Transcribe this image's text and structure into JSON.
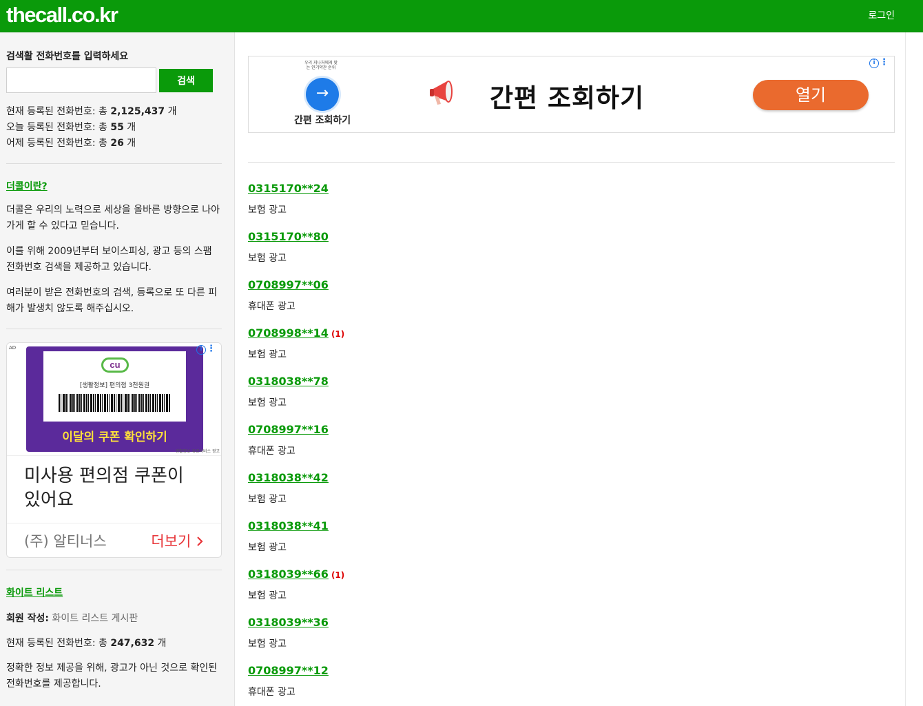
{
  "header": {
    "logo": "thecall.co.kr",
    "login": "로그인"
  },
  "sidebar": {
    "search_title": "검색활 전화번호를 입력하세요",
    "search_button": "검색",
    "stats": [
      {
        "prefix": "현재 등록된 전화번호: 총 ",
        "value": "2,125,437",
        "suffix": " 개"
      },
      {
        "prefix": "오늘 등록된 전화번호: 총 ",
        "value": "55",
        "suffix": " 개"
      },
      {
        "prefix": "어제 등록된 전화번호: 총 ",
        "value": "26",
        "suffix": " 개"
      }
    ],
    "about_link": "더콜이란?",
    "about_paragraphs": [
      "더콜은 우리의 노력으로 세상을 올바른 방향으로 나아가게 할 수 있다고 믿습니다.",
      "이를 위해 2009년부터 보이스피싱, 광고 등의 스팸 전화번호 검색을 제공하고 있습니다.",
      "여러분이 받은 전화번호의 검색, 등록으로 또 다른 피해가 발생치 않도록 해주십시오."
    ],
    "ad": {
      "tag": "AD",
      "brand": "cu",
      "ticket_label": "[생활정보] 편의점 3천원권",
      "ticket_cta": "이달의 쿠폰 확인하기",
      "fine_print": "생활정보 유료서비스 광고",
      "headline": "미사용 편의점 쿠폰이 있어요",
      "advertiser": "(주) 알티너스",
      "more": "더보기",
      "info_icon": "i",
      "dots": "⋮"
    },
    "whitelist_link": "화이트 리스트",
    "member_label": "회원 작성:",
    "member_value": " 화이트 리스트 게시판",
    "whitelist_count_prefix": "현재 등록된 전화번호: 총 ",
    "whitelist_count_value": "247,632",
    "whitelist_count_suffix": " 개",
    "whitelist_info": "정확한 정보 제공을 위해, 광고가 아닌 것으로 확인된 전화번호를 제공합니다."
  },
  "banner": {
    "mini_text": "우리 지나처에게 맞는 인기약관 순위",
    "arrow": "→",
    "sub": "간편 조회하기",
    "title": "간편 조회하기",
    "button": "열기",
    "info_icon": "i",
    "dots": "⋮"
  },
  "phones": [
    {
      "number": "0315170**24",
      "count": "",
      "category": "보험 광고"
    },
    {
      "number": "0315170**80",
      "count": "",
      "category": "보험 광고"
    },
    {
      "number": "0708997**06",
      "count": "",
      "category": "휴대폰 광고"
    },
    {
      "number": "0708998**14",
      "count": "(1)",
      "category": "보험 광고"
    },
    {
      "number": "0318038**78",
      "count": "",
      "category": "보험 광고"
    },
    {
      "number": "0708997**16",
      "count": "",
      "category": "휴대폰 광고"
    },
    {
      "number": "0318038**42",
      "count": "",
      "category": "보험 광고"
    },
    {
      "number": "0318038**41",
      "count": "",
      "category": "보험 광고"
    },
    {
      "number": "0318039**66",
      "count": "(1)",
      "category": "보험 광고"
    },
    {
      "number": "0318039**36",
      "count": "",
      "category": "보험 광고"
    },
    {
      "number": "0708997**12",
      "count": "",
      "category": "휴대폰 광고"
    }
  ],
  "colors": {
    "brand_green": "#0a9a0a",
    "count_red": "#dd0000",
    "banner_button": "#ea6a2e"
  }
}
